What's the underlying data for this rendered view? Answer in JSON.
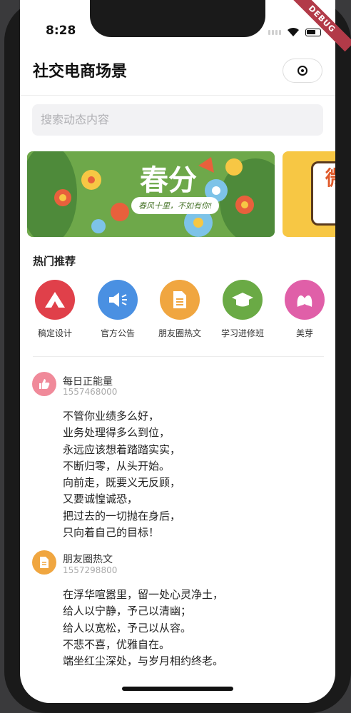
{
  "status_bar": {
    "time": "8:28",
    "debug_label": "DEBUG"
  },
  "app_bar": {
    "title": "社交电商场景"
  },
  "search": {
    "placeholder": "搜索动态内容"
  },
  "banners": [
    {
      "title": "春分",
      "subtitle": "春风十里，不如有你!"
    },
    {
      "text": "微"
    }
  ],
  "recommend": {
    "title": "热门推荐",
    "items": [
      {
        "label": "稿定设计",
        "icon": "triangle-logo-icon",
        "color": "#e0404a"
      },
      {
        "label": "官方公告",
        "icon": "megaphone-icon",
        "color": "#4a90e2"
      },
      {
        "label": "朋友圈热文",
        "icon": "document-icon",
        "color": "#f0a640"
      },
      {
        "label": "学习进修班",
        "icon": "graduation-cap-icon",
        "color": "#6aaa45"
      },
      {
        "label": "美芽",
        "icon": "meiya-logo-icon",
        "color": "#e05fa8"
      }
    ]
  },
  "feed": [
    {
      "name": "每日正能量",
      "time": "1557468000",
      "icon": "thumbs-up-icon",
      "color": "#f08a9a",
      "lines": [
        "不管你业绩多么好，",
        "业务处理得多么到位，",
        "永远应该想着踏踏实实，",
        "不断归零，从头开始。",
        "向前走，既要义无反顾，",
        "又要诚惶诚恐，",
        "把过去的一切抛在身后，",
        "只向着自己的目标！"
      ]
    },
    {
      "name": "朋友圈热文",
      "time": "1557298800",
      "icon": "document-icon",
      "color": "#f0a640",
      "lines": [
        "在浮华喧嚣里，留一处心灵净土，",
        "给人以宁静，予己以清幽；",
        "给人以宽松，予己以从容。",
        "不悲不喜，优雅自在。",
        "端坐红尘深处，与岁月相约终老。"
      ]
    }
  ]
}
